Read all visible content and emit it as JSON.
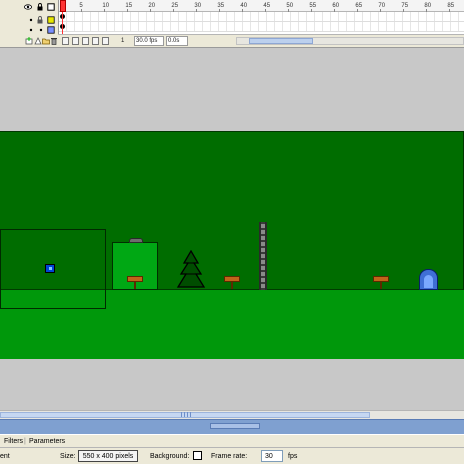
{
  "timeline": {
    "frame_numbers": [
      "1",
      "5",
      "10",
      "15",
      "20",
      "25",
      "30",
      "35",
      "40",
      "45",
      "50",
      "55",
      "60",
      "65",
      "70",
      "75",
      "80",
      "85"
    ],
    "status": {
      "current_frame": "1",
      "frame_rate": "30.0 fps",
      "elapsed_time": "0.0s"
    },
    "icons": [
      "eye-icon",
      "lock-icon",
      "outline-icon",
      "insert-layer-icon",
      "add-guide-icon",
      "insert-folder-icon",
      "delete-layer-icon",
      "center-frame-icon",
      "onion-skin-icon",
      "onion-outline-icon",
      "edit-multiple-frames-icon",
      "modify-markers-icon"
    ]
  },
  "stage": {
    "background_color": "#006d00",
    "ground_color": "#00980b",
    "pasteboard_color": "#c8c8c8"
  },
  "properties": {
    "tabs": [
      "Filters",
      "Parameters"
    ],
    "left_label": "ent",
    "size_label": "Size:",
    "size_value": "550 x 400 pixels",
    "background_label": "Background:",
    "frame_rate_label": "Frame rate:",
    "frame_rate_value": "30",
    "fps_label": "fps"
  }
}
